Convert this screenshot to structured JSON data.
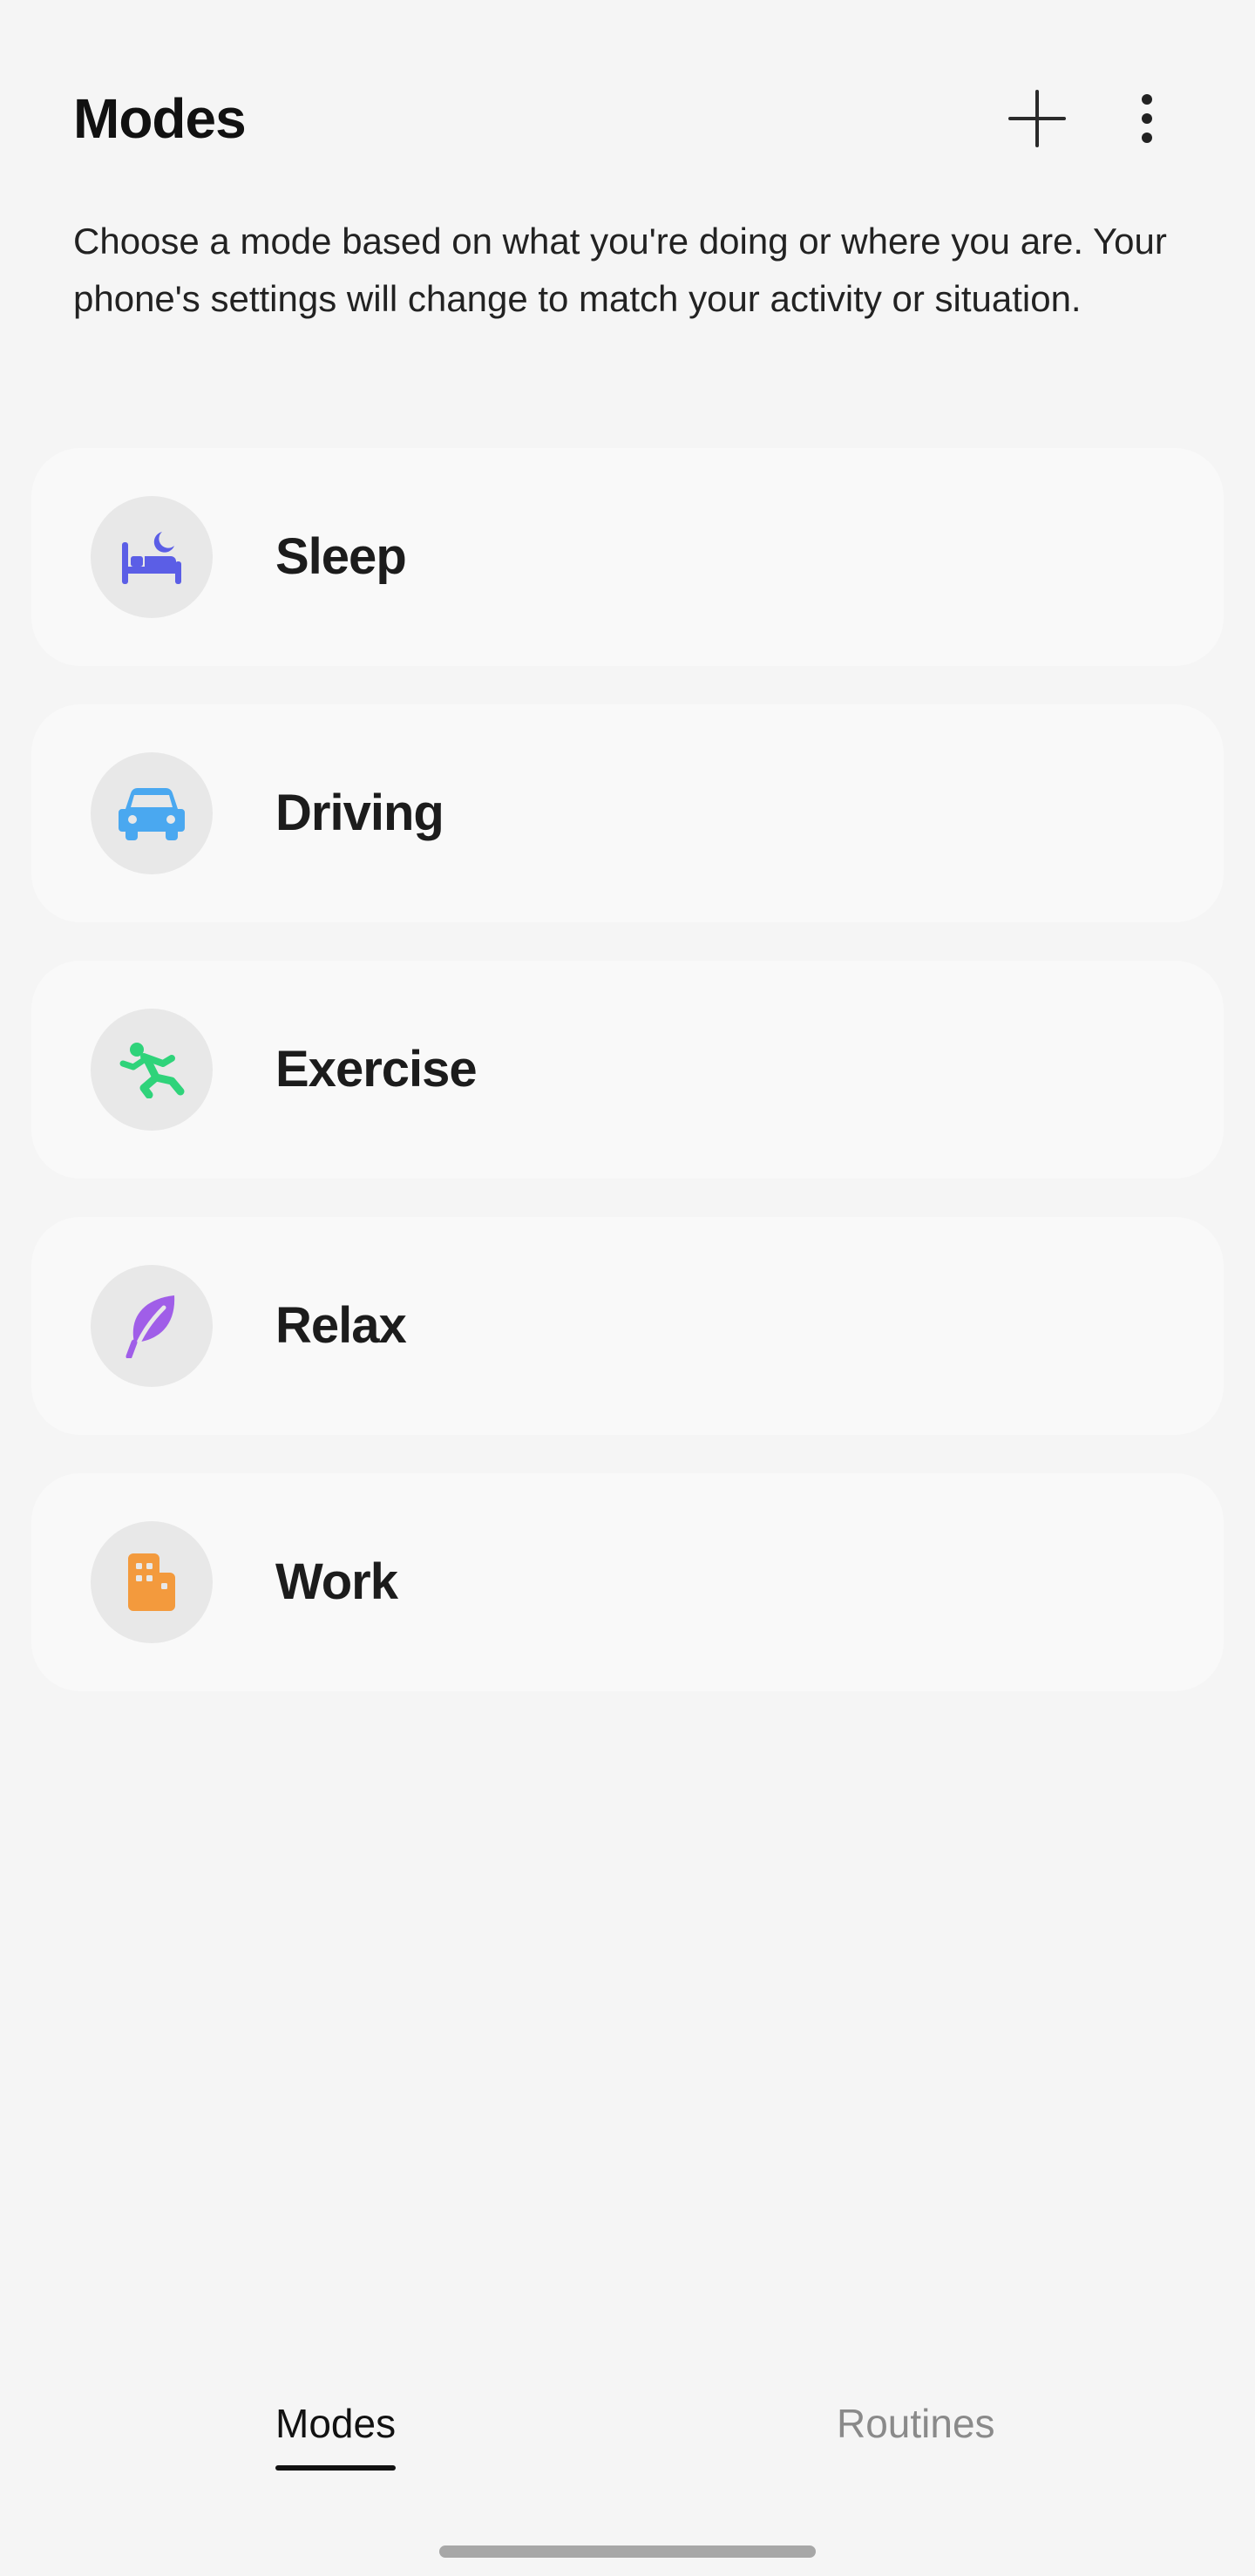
{
  "header": {
    "title": "Modes",
    "add_icon": "plus-icon",
    "more_icon": "more-vertical-icon"
  },
  "description": "Choose a mode based on what you're doing or where you are. Your phone's settings will change to match your activity or situation.",
  "modes": [
    {
      "label": "Sleep",
      "icon": "bed-moon-icon",
      "icon_color": "#5b5ee6"
    },
    {
      "label": "Driving",
      "icon": "car-icon",
      "icon_color": "#4aa8f0"
    },
    {
      "label": "Exercise",
      "icon": "running-person-icon",
      "icon_color": "#2fd37a"
    },
    {
      "label": "Relax",
      "icon": "leaf-icon",
      "icon_color": "#a05ee8"
    },
    {
      "label": "Work",
      "icon": "building-icon",
      "icon_color": "#f39a3d"
    }
  ],
  "tabs": [
    {
      "label": "Modes",
      "selected": true
    },
    {
      "label": "Routines",
      "selected": false
    }
  ],
  "colors": {
    "background": "#f5f5f5",
    "card": "#f9f9f9",
    "icon_circle": "#e8e8e8",
    "tab_inactive": "#8a8a8a"
  }
}
